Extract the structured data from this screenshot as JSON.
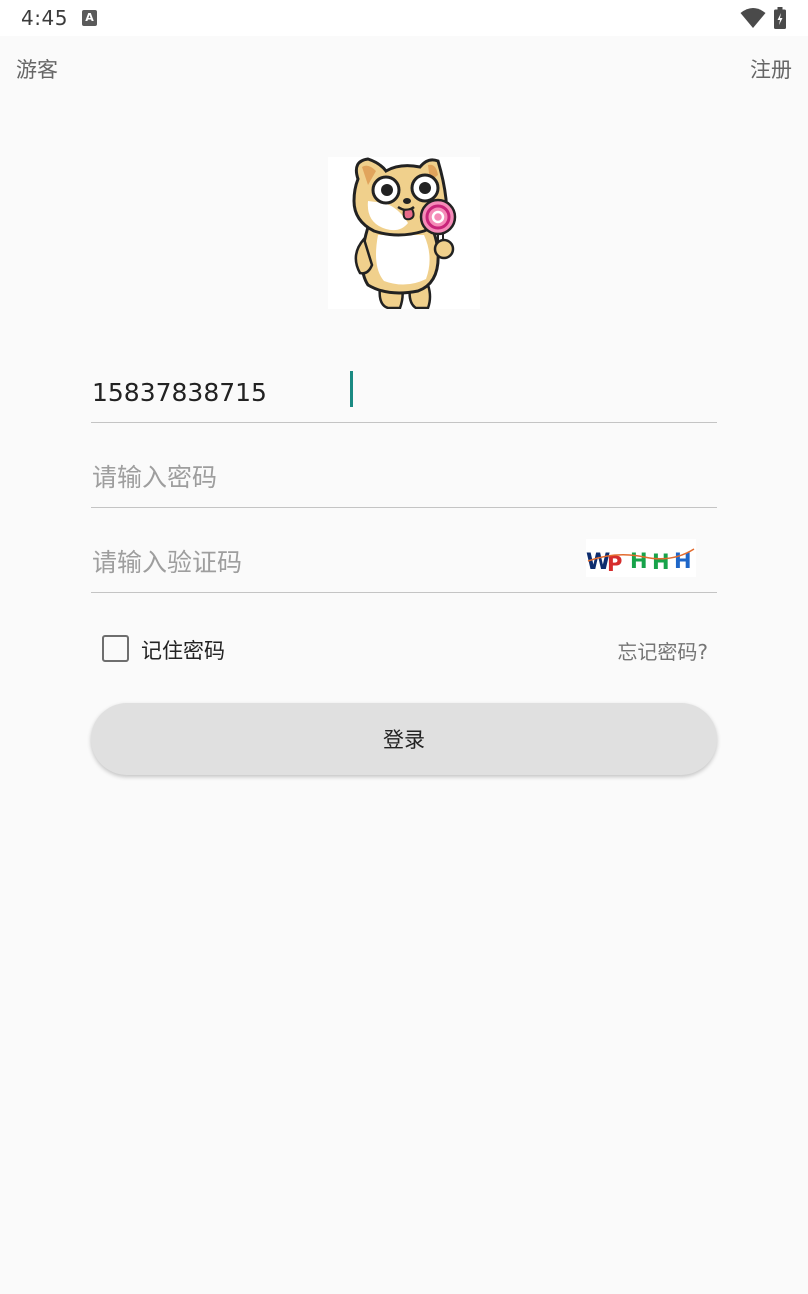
{
  "status_bar": {
    "time": "4:45",
    "notification_letter": "A",
    "icons": [
      "wifi-icon",
      "battery-charging-icon"
    ]
  },
  "toolbar": {
    "guest_label": "游客",
    "register_label": "注册"
  },
  "avatar": {
    "icon": "cartoon-dog-with-lollipop"
  },
  "form": {
    "phone_value": "15837838715",
    "password_placeholder": "请输入密码",
    "captcha_placeholder": "请输入验证码",
    "captcha_text": "WPHHH",
    "remember_label": "记住密码",
    "remember_checked": false,
    "forgot_label": "忘记密码?",
    "login_label": "登录"
  },
  "colors": {
    "background": "#fafafa",
    "accent_caret": "#1a8a82",
    "button_bg": "#e0e0e0",
    "captcha_colors": [
      "#0d2d6e",
      "#d62d2d",
      "#17a34a",
      "#17a34a",
      "#1e66c8"
    ]
  }
}
